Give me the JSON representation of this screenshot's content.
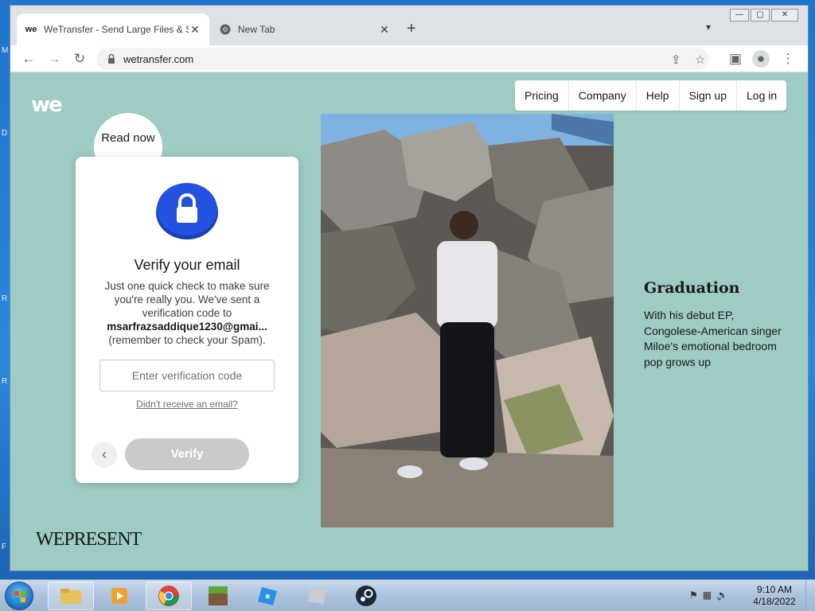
{
  "browser": {
    "tabs": [
      {
        "title": "WeTransfer - Send Large Files & Share Photos Online",
        "favicon": "we-logo-icon",
        "active": true
      },
      {
        "title": "New Tab",
        "favicon": "chrome-icon",
        "active": false
      }
    ],
    "url": "wetransfer.com"
  },
  "site": {
    "logo": "we",
    "nav": [
      {
        "label": "Pricing"
      },
      {
        "label": "Company"
      },
      {
        "label": "Help"
      },
      {
        "label": "Sign up"
      },
      {
        "label": "Log in"
      }
    ],
    "read_now": "Read now"
  },
  "verify_card": {
    "title": "Verify your email",
    "body": "Just one quick check to make sure you're really you. We've sent a verification code to",
    "email": "msarfrazsaddique1230@gmai...",
    "note": "(remember to check your Spam).",
    "input_placeholder": "Enter verification code",
    "resend_link": "Didn't receive an email?",
    "verify_button": "Verify"
  },
  "article": {
    "title": "Graduation",
    "description": "With his debut EP, Congolese-American singer Miloe's emotional bedroom pop grows up",
    "brand": "WEPRESENT"
  },
  "taskbar": {
    "time": "9:10 AM",
    "date": "4/18/2022",
    "items": [
      "file-explorer-icon",
      "media-player-icon",
      "chrome-icon",
      "minecraft-icon",
      "roblox-icon",
      "app-icon",
      "steam-icon"
    ]
  },
  "desktop_letters": [
    "M",
    "D",
    "R",
    "R",
    "F"
  ],
  "colors": {
    "page_bg": "#9ecbc3",
    "lock_blue": "#1f4fd8",
    "verify_disabled": "#c8cacc"
  }
}
